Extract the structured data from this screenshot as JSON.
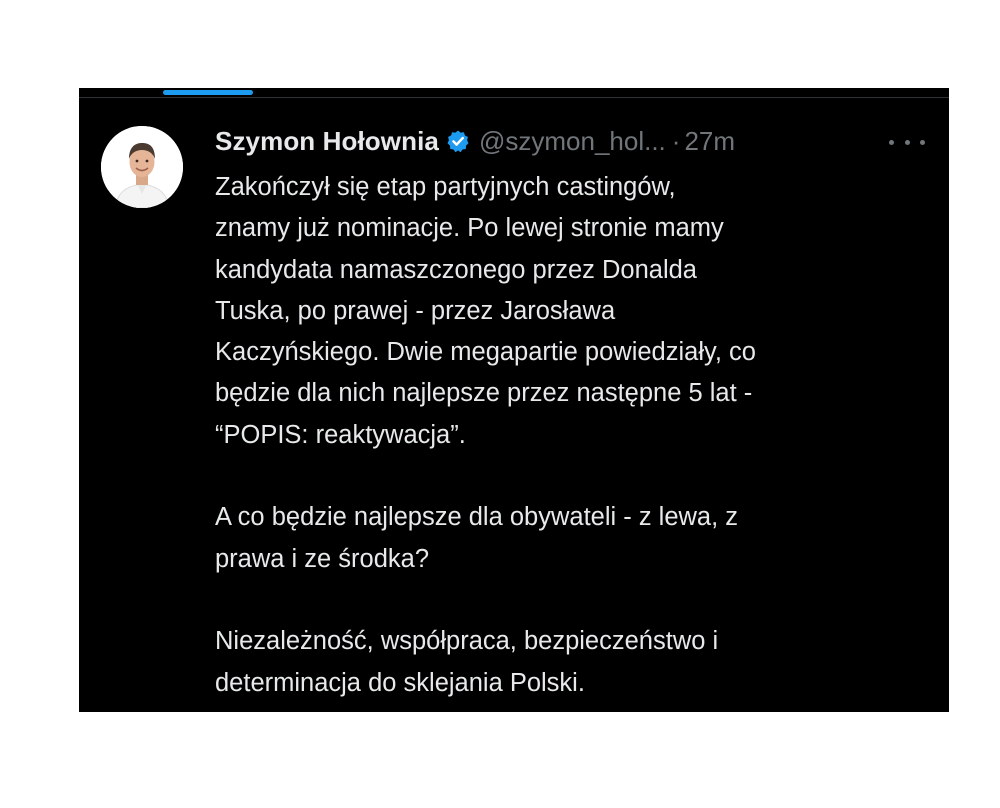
{
  "tweet": {
    "author": {
      "display_name": "Szymon Hołownia",
      "handle": "@szymon_hol...",
      "verified_icon": "verified-badge-icon",
      "verified_color": "#1d9bf0"
    },
    "separator": "·",
    "timestamp": "27m",
    "more_icon": "more-options-icon",
    "paragraphs": [
      {
        "lines": [
          "Zakończył się etap partyjnych castingów,",
          "znamy już nominacje. Po lewej stronie mamy",
          "kandydata namaszczonego przez Donalda",
          "Tuska, po prawej - przez Jarosława",
          "Kaczyńskiego. Dwie megapartie powiedziały, co",
          "będzie dla nich najlepsze przez następne 5 lat -",
          "“POPIS: reaktywacja”."
        ]
      },
      {
        "lines": [
          "A co będzie najlepsze dla obywateli - z lewa, z",
          "prawa i ze środka?"
        ]
      },
      {
        "lines": [
          "Niezależność, współpraca, bezpieczeństwo i",
          "determinacja do sklejania Polski."
        ]
      }
    ]
  },
  "theme": {
    "background": "#000000",
    "text": "#e7e9ea",
    "secondary_text": "#71767b",
    "accent": "#1d9bf0",
    "page_background": "#ffffff"
  }
}
